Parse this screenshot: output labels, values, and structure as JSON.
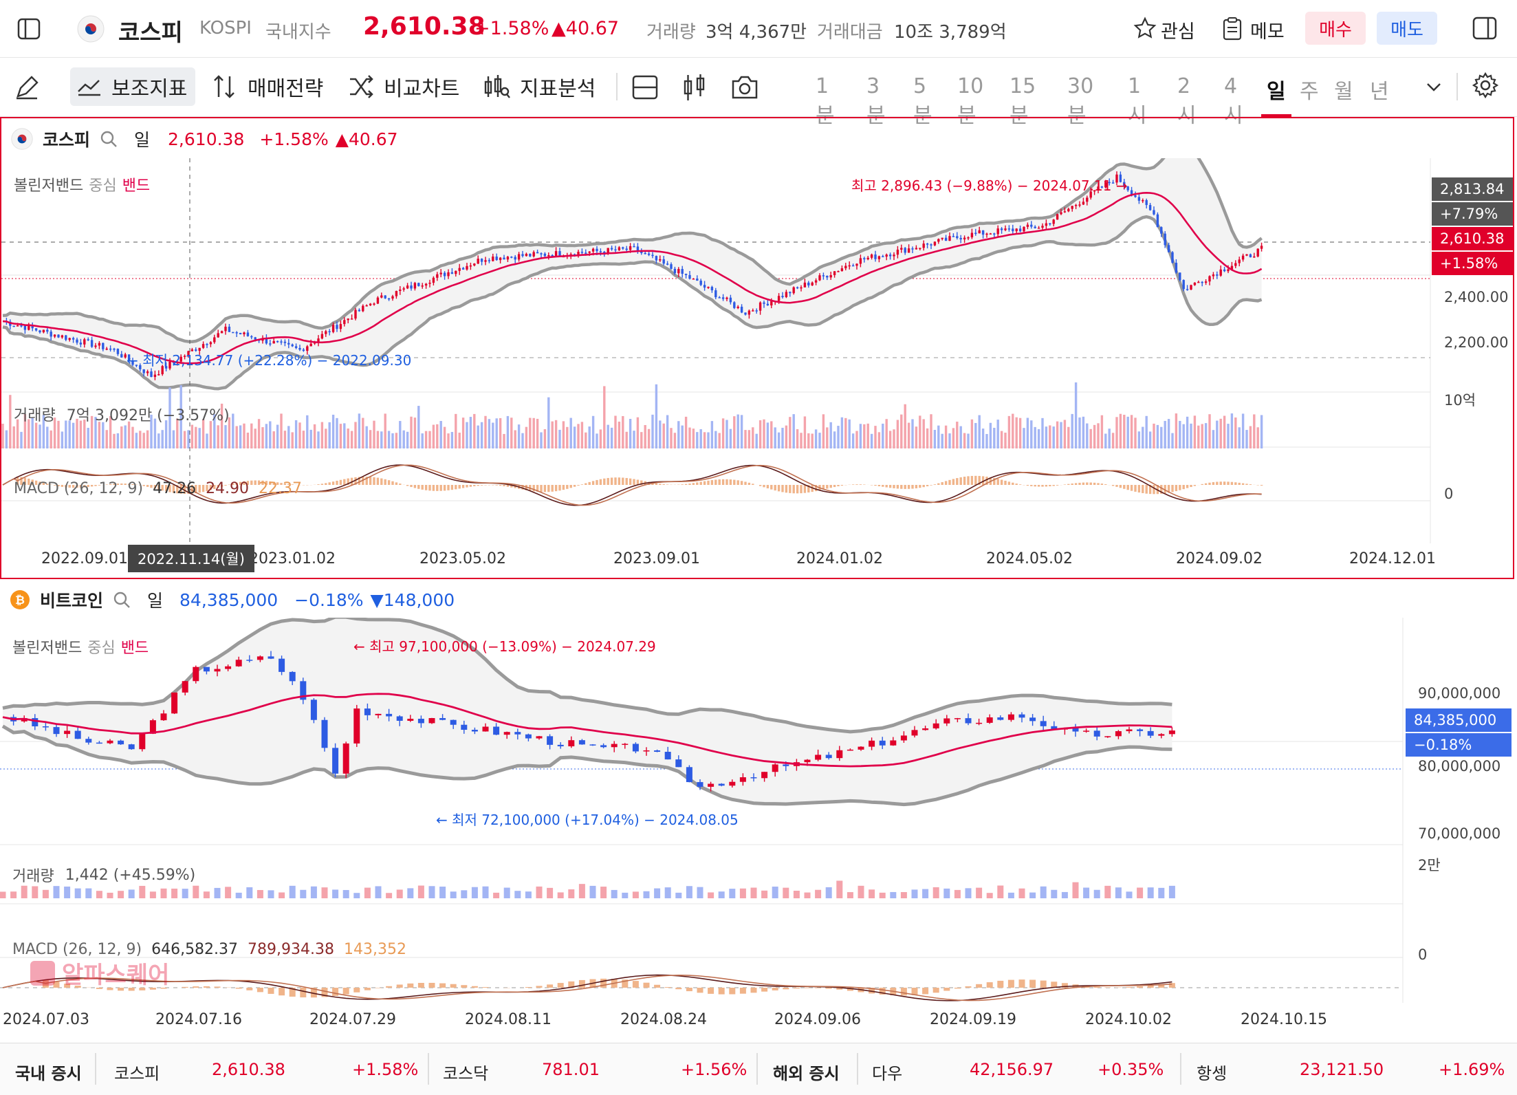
{
  "header": {
    "name": "코스피",
    "code": "KOSPI",
    "category": "국내지수",
    "price": "2,610.38",
    "change_pct": "+1.58%",
    "change_amt": "▲40.67",
    "volume_label": "거래량",
    "volume": "3억 4,367만",
    "amount_label": "거래대금",
    "amount": "10조 3,789억",
    "watch": "관심",
    "memo": "메모",
    "buy": "매수",
    "sell": "매도"
  },
  "toolbar": {
    "aux": "보조지표",
    "strategy": "매매전략",
    "compare": "비교차트",
    "analysis": "지표분석",
    "timeframes": [
      "1분",
      "3분",
      "5분",
      "10분",
      "15분",
      "30분",
      "1시",
      "2시",
      "4시",
      "일",
      "주",
      "월",
      "년"
    ],
    "active_tf": "일"
  },
  "kospi": {
    "name": "코스피",
    "period": "일",
    "price": "2,610.38",
    "change_pct": "+1.58%",
    "change_amt": "▲40.67",
    "bb_label": "볼린저밴드",
    "bb_center": "중심",
    "bb_band": "밴드",
    "high_note": "최고 2,896.43 (−9.88%) − 2024.07.11 →",
    "low_note": "← 최저 2,134.77 (+22.28%) − 2022.09.30",
    "axis": [
      "2,400.00",
      "2,200.00"
    ],
    "crosshair_val": "2,813.84",
    "crosshair_pct": "+7.79%",
    "last_val": "2,610.38",
    "last_pct": "+1.58%",
    "vol_label": "거래량",
    "vol_value": "7억 3,092만 (−3.57%)",
    "vol_axis": "10억",
    "macd_label": "MACD (26, 12, 9)",
    "macd_v1": "47.26",
    "macd_v2": "24.90",
    "macd_v3": "22.37",
    "macd_axis": "0",
    "dates": [
      "2022.09.01",
      "2023.01.02",
      "2023.05.02",
      "2023.09.01",
      "2024.01.02",
      "2024.05.02",
      "2024.09.02",
      "2024.12.01"
    ],
    "cursor_date": "2022.11.14(월)"
  },
  "btc": {
    "name": "비트코인",
    "period": "일",
    "price": "84,385,000",
    "change_pct": "−0.18%",
    "change_amt": "▼148,000",
    "bb_label": "볼린저밴드",
    "bb_center": "중심",
    "bb_band": "밴드",
    "high_note": "← 최고 97,100,000 (−13.09%) − 2024.07.29",
    "low_note": "← 최저 72,100,000 (+17.04%) − 2024.08.05",
    "axis": [
      "90,000,000",
      "80,000,000",
      "70,000,000"
    ],
    "last_val": "84,385,000",
    "last_pct": "−0.18%",
    "vol_label": "거래량",
    "vol_value": "1,442 (+45.59%)",
    "vol_axis": "2만",
    "macd_label": "MACD (26, 12, 9)",
    "macd_v1": "646,582.37",
    "macd_v2": "789,934.38",
    "macd_v3": "143,352",
    "macd_axis": "0",
    "watermark": "알파스퀘어",
    "dates": [
      "2024.07.03",
      "2024.07.16",
      "2024.07.29",
      "2024.08.11",
      "2024.08.24",
      "2024.09.06",
      "2024.09.19",
      "2024.10.02",
      "2024.10.15"
    ]
  },
  "footer": {
    "domestic": "국내 증시",
    "kospi_name": "코스피",
    "kospi_val": "2,610.38",
    "kospi_pct": "+1.58%",
    "kosdaq_name": "코스닥",
    "kosdaq_val": "781.01",
    "kosdaq_pct": "+1.56%",
    "overseas": "해외 증시",
    "dow_name": "다우",
    "dow_val": "42,156.97",
    "dow_pct": "+0.35%",
    "hs_name": "항셍",
    "hs_val": "23,121.50",
    "hs_pct": "+1.69%"
  },
  "colors": {
    "up": "#e0002a",
    "down": "#1f5fe0",
    "band": "#9a9a9a",
    "mid": "#e0004a"
  }
}
